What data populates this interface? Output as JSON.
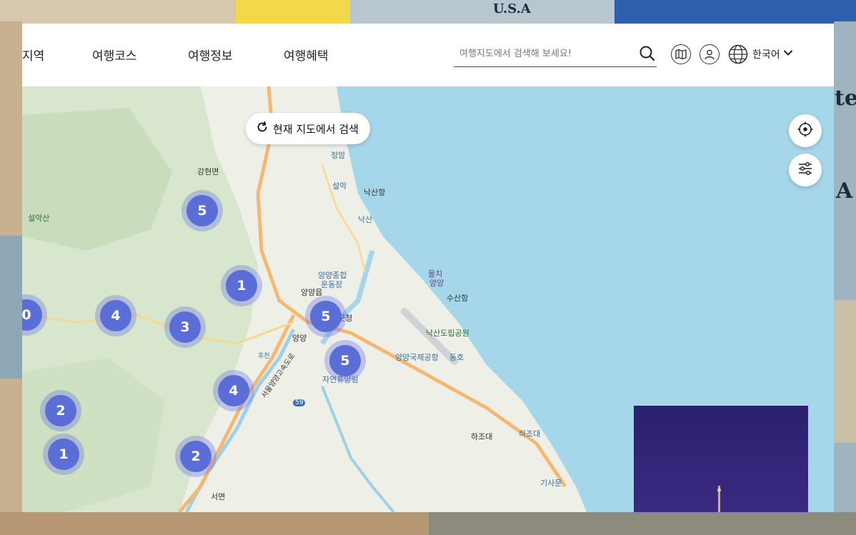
{
  "nav": {
    "items": [
      "지역",
      "여행코스",
      "여행정보",
      "여행혜택"
    ]
  },
  "search": {
    "placeholder": "여행지도에서 검색해 보세요!",
    "icon": "search-icon"
  },
  "header_icons": [
    "map-icon",
    "user-icon",
    "globe-icon"
  ],
  "language": {
    "label": "한국어",
    "icon": "chevron-down-icon"
  },
  "map": {
    "search_here_label": "현재 지도에서 검색",
    "controls": [
      "locate-icon",
      "filter-sliders-icon"
    ],
    "labels": [
      {
        "text": "강현면",
        "tone": "default"
      },
      {
        "text": "설악산",
        "tone": "green"
      },
      {
        "text": "정암",
        "tone": "blue"
      },
      {
        "text": "설악",
        "tone": "blue"
      },
      {
        "text": "낙산항",
        "tone": "default"
      },
      {
        "text": "낙산",
        "tone": "blue"
      },
      {
        "text": "양양종합",
        "tone": "blue"
      },
      {
        "text": "운동장",
        "tone": "blue"
      },
      {
        "text": "물치",
        "tone": "purple"
      },
      {
        "text": "양양",
        "tone": "purple"
      },
      {
        "text": "양양읍",
        "tone": "default"
      },
      {
        "text": "수산항",
        "tone": "default"
      },
      {
        "text": "군청",
        "tone": "default"
      },
      {
        "text": "낙산도립공원",
        "tone": "green"
      },
      {
        "text": "양양",
        "tone": "default"
      },
      {
        "text": "양양국제공항",
        "tone": "blue"
      },
      {
        "text": "동호",
        "tone": "blue"
      },
      {
        "text": "자연휴양림",
        "tone": "blue"
      },
      {
        "text": "서울양양고속도로",
        "tone": "default"
      },
      {
        "text": "하조대",
        "tone": "default"
      },
      {
        "text": "하조대",
        "tone": "blue"
      },
      {
        "text": "기사문",
        "tone": "blue"
      },
      {
        "text": "서면",
        "tone": "default"
      },
      {
        "text": "후천",
        "tone": "blue"
      },
      {
        "text": "59",
        "tone": "default"
      }
    ],
    "clusters": [
      "5",
      "1",
      "0",
      "4",
      "3",
      "5",
      "5",
      "4",
      "2",
      "1",
      "2"
    ]
  },
  "colors": {
    "cluster": "#5b6dd6",
    "sea": "#a6d6ea",
    "land": "#eef0e8",
    "promo": "#2a1f66"
  }
}
